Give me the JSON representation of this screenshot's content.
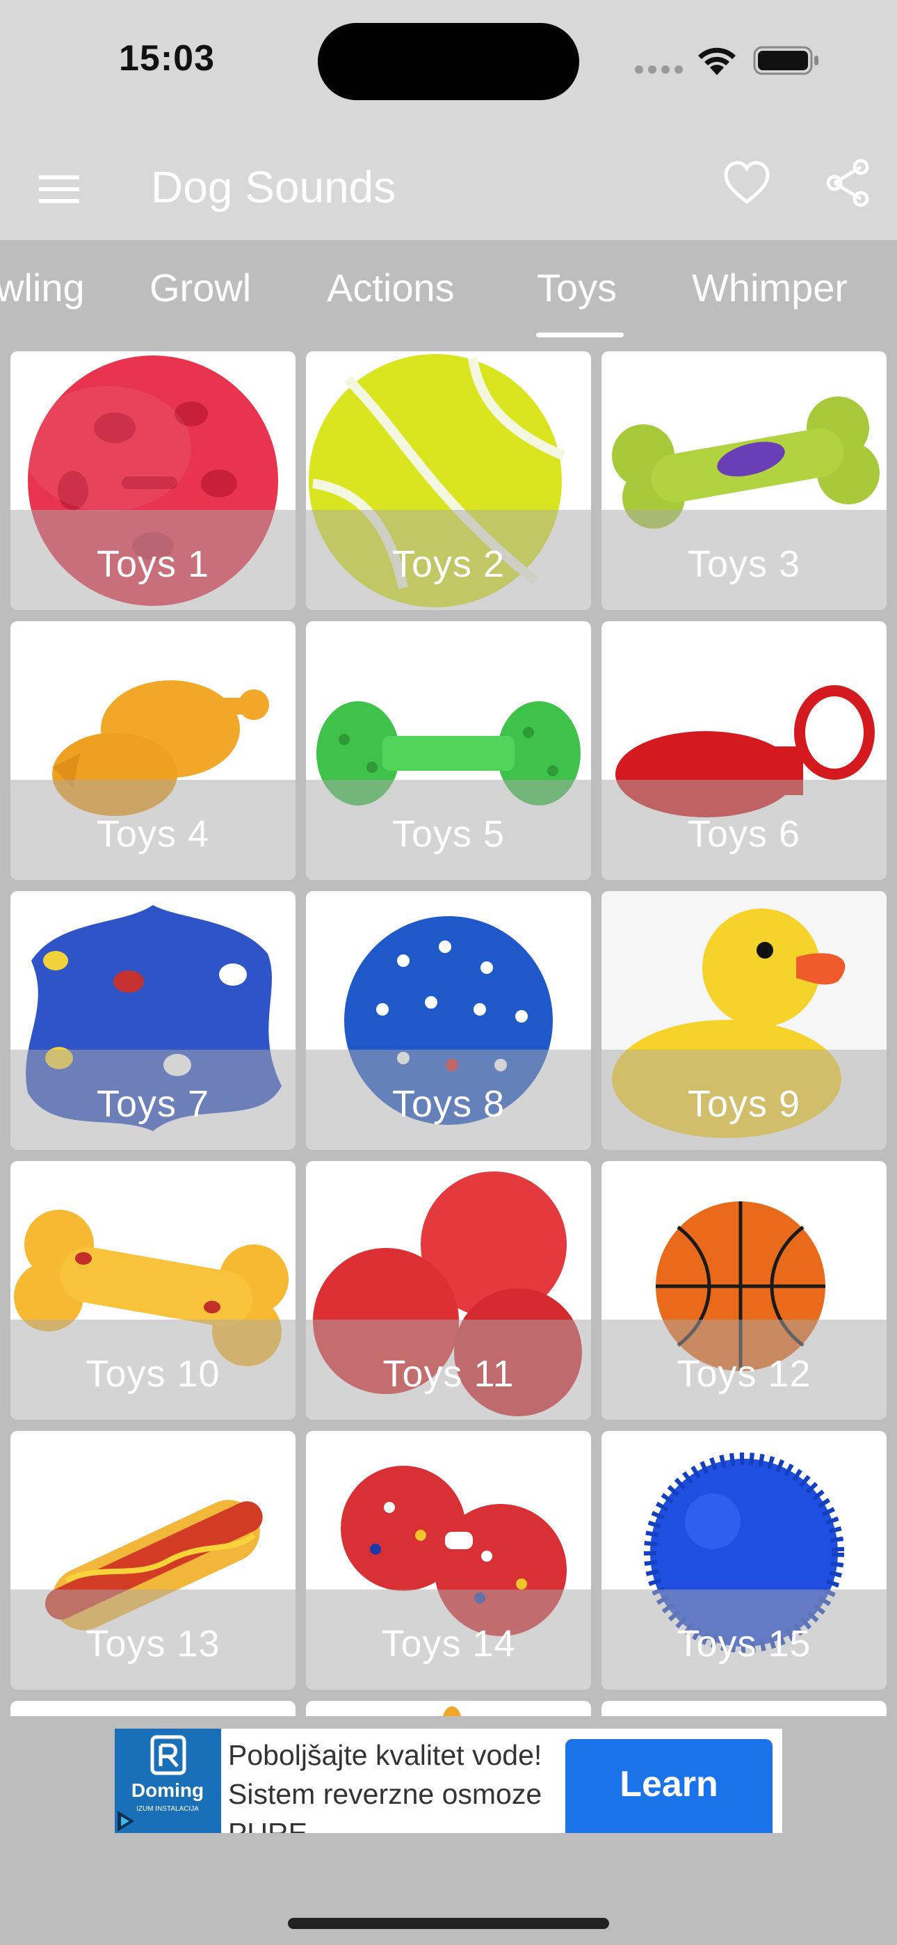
{
  "status_bar": {
    "time": "15:03"
  },
  "app_bar": {
    "title": "Dog Sounds",
    "icons": [
      "menu-icon",
      "heart-icon",
      "share-icon"
    ]
  },
  "tabs": [
    {
      "label": "wling",
      "selected": false
    },
    {
      "label": "Growl",
      "selected": false
    },
    {
      "label": "Actions",
      "selected": false
    },
    {
      "label": "Toys",
      "selected": true
    },
    {
      "label": "Whimper",
      "selected": false
    }
  ],
  "grid": {
    "items": [
      {
        "label": "Toys 1",
        "image": "red-paw-ball"
      },
      {
        "label": "Toys 2",
        "image": "tennis-ball"
      },
      {
        "label": "Toys 3",
        "image": "green-bone"
      },
      {
        "label": "Toys 4",
        "image": "orange-chicken"
      },
      {
        "label": "Toys 5",
        "image": "green-dumbbell"
      },
      {
        "label": "Toys 6",
        "image": "red-pacifier"
      },
      {
        "label": "Toys 7",
        "image": "blue-star-paws"
      },
      {
        "label": "Toys 8",
        "image": "blue-spiky-ball"
      },
      {
        "label": "Toys 9",
        "image": "rubber-duck"
      },
      {
        "label": "Toys 10",
        "image": "yellow-bone"
      },
      {
        "label": "Toys 11",
        "image": "red-balls"
      },
      {
        "label": "Toys 12",
        "image": "basketball"
      },
      {
        "label": "Toys 13",
        "image": "hotdog"
      },
      {
        "label": "Toys 14",
        "image": "red-spiky-balls"
      },
      {
        "label": "Toys 15",
        "image": "blue-spiky-sphere"
      }
    ]
  },
  "ad": {
    "text": "Poboljšajte kvalitet vode! Sistem reverzne osmoze PURE",
    "logo_text": "Doming",
    "logo_subtext": "IZUM INSTALACIJA",
    "button_label": "Learn"
  },
  "colors": {
    "app_bar_bg": "#d8d8d8",
    "tab_bar_bg": "#bdbdbd",
    "ad_button": "#1a73e8"
  }
}
